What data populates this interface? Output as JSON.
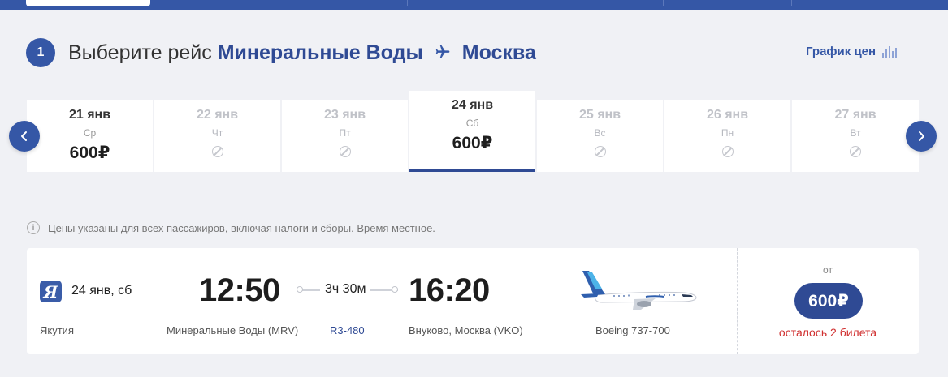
{
  "step": {
    "number": "1"
  },
  "heading": {
    "prefix": "Выберите рейс",
    "origin": "Минеральные Воды",
    "destination": "Москва"
  },
  "price_chart_link": {
    "label": "График цен"
  },
  "date_strip": {
    "days": [
      {
        "date": "21 янв",
        "dow": "Ср",
        "price": "600₽",
        "has_flights": true,
        "selected": false
      },
      {
        "date": "22 янв",
        "dow": "Чт",
        "price": "",
        "has_flights": false,
        "selected": false
      },
      {
        "date": "23 янв",
        "dow": "Пт",
        "price": "",
        "has_flights": false,
        "selected": false
      },
      {
        "date": "24 янв",
        "dow": "Сб",
        "price": "600₽",
        "has_flights": true,
        "selected": true
      },
      {
        "date": "25 янв",
        "dow": "Вс",
        "price": "",
        "has_flights": false,
        "selected": false
      },
      {
        "date": "26 янв",
        "dow": "Пн",
        "price": "",
        "has_flights": false,
        "selected": false
      },
      {
        "date": "27 янв",
        "dow": "Вт",
        "price": "",
        "has_flights": false,
        "selected": false
      }
    ]
  },
  "info_note": "Цены указаны для всех пассажиров, включая налоги и сборы. Время местное.",
  "flight": {
    "logo_letter": "Я",
    "date": "24 янв, сб",
    "airline": "Якутия",
    "departure_time": "12:50",
    "departure_airport": "Минеральные Воды (MRV)",
    "duration": "3ч 30м",
    "flight_number": "R3-480",
    "arrival_time": "16:20",
    "arrival_airport": "Внуково, Москва (VKO)",
    "aircraft": "Boeing 737-700",
    "from_label": "от",
    "price": "600₽",
    "seats_left": "осталось 2 билета"
  },
  "colors": {
    "brand": "#3557a6",
    "brand_dark": "#2f4a94",
    "background": "#f0f1f5",
    "warning": "#d03030"
  }
}
